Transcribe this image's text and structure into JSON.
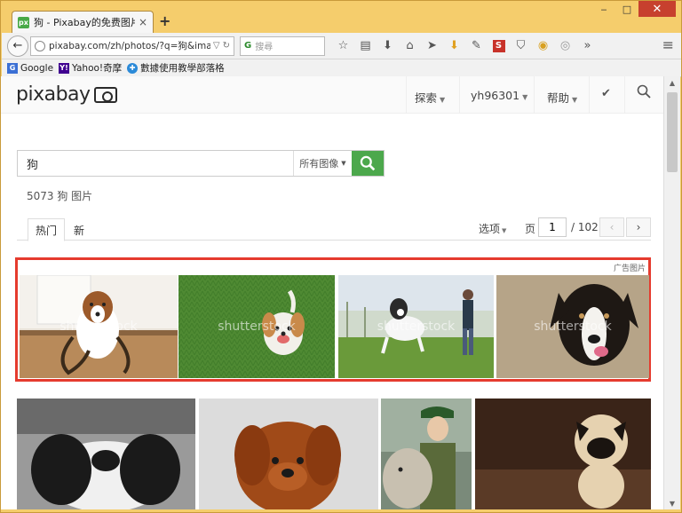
{
  "browser": {
    "tab_favicon": "px",
    "tab_title": "狗 - Pixabay的免费图片",
    "tab_close": "×",
    "new_tab": "+",
    "url": "pixabay.com/zh/photos/?q=狗&image_type=",
    "search_placeholder": "搜尋",
    "window_controls": {
      "minimize": "‒",
      "maximize": "□",
      "close": "✕"
    },
    "bookmarks": [
      {
        "label": "Google",
        "icon": "G"
      },
      {
        "label": "Yahoo!奇摩",
        "icon": "Y!"
      },
      {
        "label": "數據使用教學部落格",
        "icon": "✚"
      }
    ]
  },
  "site": {
    "logo": "pixabay",
    "nav": {
      "explore": "探索",
      "user": "yh96301",
      "help": "帮助"
    },
    "search": {
      "query": "狗",
      "type_label": "所有图像"
    },
    "result_count": "5073 狗 图片",
    "tabs": {
      "hot": "热门",
      "new": "新"
    },
    "options_label": "选项",
    "page_label": "页",
    "page_current": "1",
    "page_total": "/ 102",
    "prev": "‹",
    "next": "›",
    "ad_label": "广告图片",
    "watermark": "shutterstock"
  },
  "colors": {
    "highlight_border": "#e53b2e",
    "search_button": "#4ca84c",
    "browser_frame": "#f5cd6c"
  }
}
